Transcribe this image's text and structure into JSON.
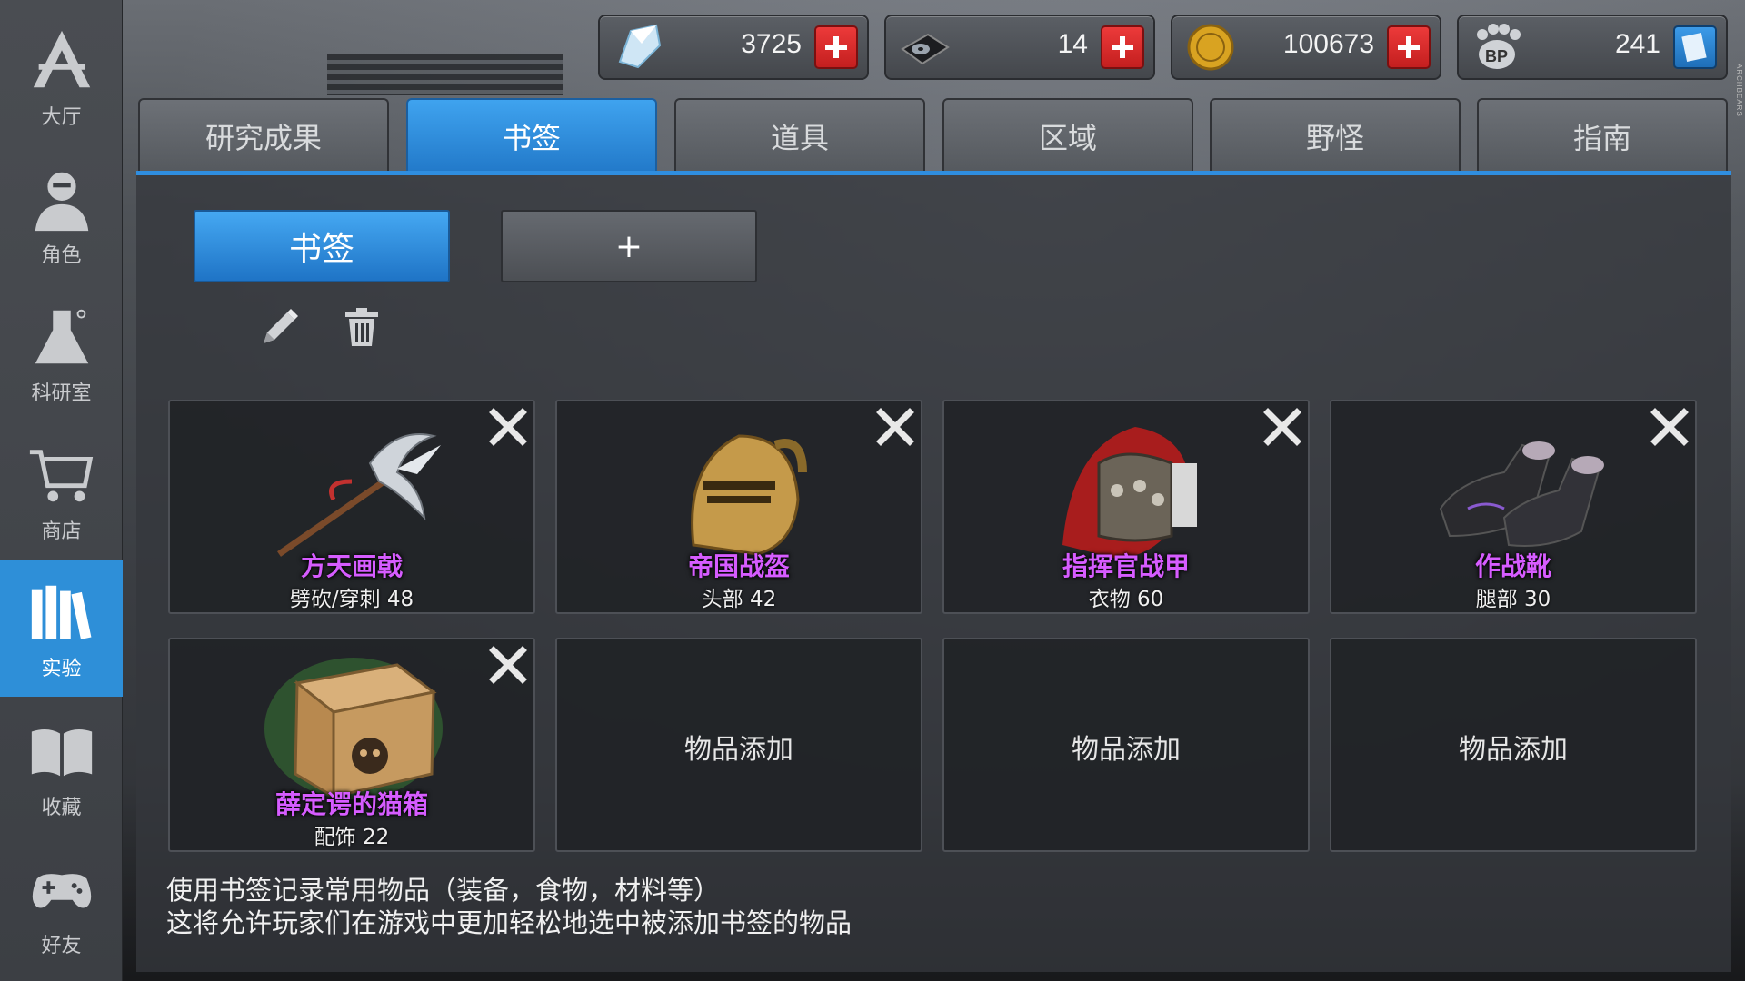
{
  "colors": {
    "accent_blue": "#2e8fd8",
    "add_red": "#d42a2a",
    "item_purple": "#d65cff"
  },
  "sidebar": {
    "items": [
      {
        "label": "大厅",
        "icon": "lobby-icon",
        "active": false
      },
      {
        "label": "角色",
        "icon": "character-icon",
        "active": false
      },
      {
        "label": "科研室",
        "icon": "lab-flask-icon",
        "active": false
      },
      {
        "label": "商店",
        "icon": "shopping-cart-icon",
        "active": false
      },
      {
        "label": "实验",
        "icon": "books-icon",
        "active": true
      },
      {
        "label": "收藏",
        "icon": "open-book-icon",
        "active": false
      },
      {
        "label": "好友",
        "icon": "gamepad-icon",
        "active": false
      }
    ]
  },
  "currencies": [
    {
      "icon": "crystal-icon",
      "value": "3725"
    },
    {
      "icon": "disk-icon",
      "value": "14"
    },
    {
      "icon": "gold-coin-icon",
      "value": "100673"
    },
    {
      "icon": "bp-paw-icon",
      "value": "241"
    }
  ],
  "side_strip": "ARCHBEARS",
  "tabs": [
    {
      "label": "研究成果",
      "active": false
    },
    {
      "label": "书签",
      "active": true
    },
    {
      "label": "道具",
      "active": false
    },
    {
      "label": "区域",
      "active": false
    },
    {
      "label": "野怪",
      "active": false
    },
    {
      "label": "指南",
      "active": false
    }
  ],
  "bookmark_bar": {
    "current_label": "书签",
    "add_label": "+"
  },
  "slots": [
    {
      "name": "方天画戟",
      "sub": "劈砍/穿刺 48",
      "art": "halberd-icon",
      "empty": false
    },
    {
      "name": "帝国战盔",
      "sub": "头部 42",
      "art": "helmet-icon",
      "empty": false
    },
    {
      "name": "指挥官战甲",
      "sub": "衣物 60",
      "art": "armor-icon",
      "empty": false
    },
    {
      "name": "作战靴",
      "sub": "腿部 30",
      "art": "boots-icon",
      "empty": false
    },
    {
      "name": "薛定谔的猫箱",
      "sub": "配饰 22",
      "art": "cat-box-icon",
      "empty": false
    },
    {
      "empty_label": "物品添加",
      "empty": true
    },
    {
      "empty_label": "物品添加",
      "empty": true
    },
    {
      "empty_label": "物品添加",
      "empty": true
    }
  ],
  "description": {
    "line1": "使用书签记录常用物品（装备，食物，材料等）",
    "line2": "这将允许玩家们在游戏中更加轻松地选中被添加书签的物品"
  }
}
